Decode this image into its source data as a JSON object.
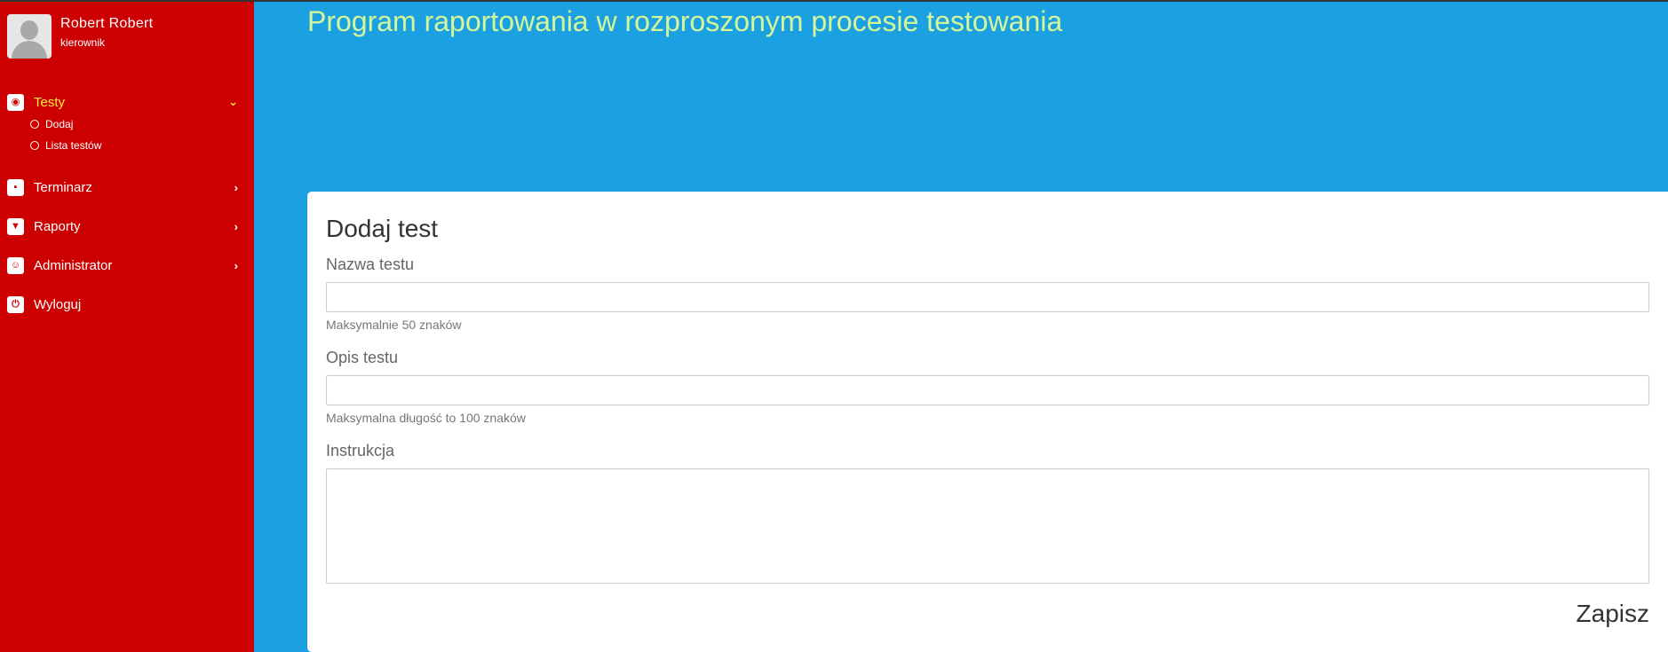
{
  "colors": {
    "sidebar_bg": "#cc0000",
    "main_bg": "#1ba1e2",
    "title_color": "#d4f79a",
    "active_nav": "#ffeb3b"
  },
  "user": {
    "name": "Robert Robert",
    "role": "kierownik"
  },
  "sidebar": {
    "items": [
      {
        "label": "Testy",
        "icon": "dashboard-icon",
        "active": true,
        "expanded": true,
        "subitems": [
          {
            "label": "Dodaj"
          },
          {
            "label": "Lista testów"
          }
        ]
      },
      {
        "label": "Terminarz",
        "icon": "document-icon"
      },
      {
        "label": "Raporty",
        "icon": "filter-icon"
      },
      {
        "label": "Administrator",
        "icon": "smiley-icon"
      },
      {
        "label": "Wyloguj",
        "icon": "power-icon"
      }
    ]
  },
  "header": {
    "title": "Program raportowania w rozproszonym procesie testowania"
  },
  "form": {
    "title": "Dodaj test",
    "fields": [
      {
        "label": "Nazwa testu",
        "value": "",
        "help": "Maksymalnie 50 znaków"
      },
      {
        "label": "Opis testu",
        "value": "",
        "help": "Maksymalna długość to 100 znaków"
      },
      {
        "label": "Instrukcja",
        "value": ""
      }
    ],
    "submit_label": "Zapisz"
  }
}
